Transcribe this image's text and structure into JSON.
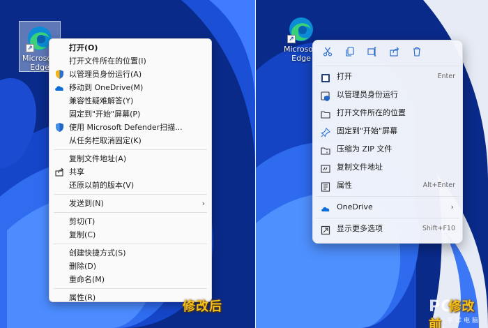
{
  "colors": {
    "accent": "#0067c0",
    "wallpaper_dark": "#0a2a8a",
    "wallpaper_light": "#e8ecf6",
    "caption": "#f4c21a"
  },
  "desktop_icon": {
    "label_line1": "Microsoft",
    "label_line2": "Edge",
    "icon": "edge-icon",
    "overlay": "shortcut-arrow-icon"
  },
  "classic_menu": {
    "groups": [
      [
        {
          "label": "打开(O)",
          "bold": true,
          "icon": ""
        },
        {
          "label": "打开文件所在的位置(I)",
          "icon": ""
        },
        {
          "label": "以管理员身份运行(A)",
          "icon": "shield-icon"
        },
        {
          "label": "移动到 OneDrive(M)",
          "icon": "onedrive-icon"
        },
        {
          "label": "兼容性疑难解答(Y)",
          "icon": ""
        },
        {
          "label": "固定到\"开始\"屏幕(P)",
          "icon": ""
        },
        {
          "label": "使用 Microsoft Defender扫描...",
          "icon": "defender-icon"
        },
        {
          "label": "从任务栏取消固定(K)",
          "icon": ""
        }
      ],
      [
        {
          "label": "复制文件地址(A)",
          "icon": ""
        },
        {
          "label": "共享",
          "icon": "share-icon"
        },
        {
          "label": "还原以前的版本(V)",
          "icon": ""
        }
      ],
      [
        {
          "label": "发送到(N)",
          "icon": "",
          "submenu": true
        }
      ],
      [
        {
          "label": "剪切(T)",
          "icon": ""
        },
        {
          "label": "复制(C)",
          "icon": ""
        }
      ],
      [
        {
          "label": "创建快捷方式(S)",
          "icon": ""
        },
        {
          "label": "删除(D)",
          "icon": ""
        },
        {
          "label": "重命名(M)",
          "icon": ""
        }
      ],
      [
        {
          "label": "属性(R)",
          "icon": ""
        }
      ]
    ]
  },
  "modern_menu": {
    "toolbar": [
      "cut-icon",
      "copy-icon",
      "rename-icon",
      "share-icon",
      "delete-icon"
    ],
    "items_top": [
      {
        "label": "打开",
        "shortcut": "Enter",
        "icon": "app-icon"
      },
      {
        "label": "以管理员身份运行",
        "shortcut": "",
        "icon": "admin-icon"
      },
      {
        "label": "打开文件所在的位置",
        "shortcut": "",
        "icon": "folder-icon"
      },
      {
        "label": "固定到\"开始\"屏幕",
        "shortcut": "",
        "icon": "pin-icon"
      },
      {
        "label": "压缩为 ZIP 文件",
        "shortcut": "",
        "icon": "zip-icon"
      },
      {
        "label": "复制文件地址",
        "shortcut": "",
        "icon": "copy-path-icon"
      },
      {
        "label": "属性",
        "shortcut": "Alt+Enter",
        "icon": "properties-icon"
      }
    ],
    "onedrive": {
      "label": "OneDrive",
      "icon": "onedrive-icon"
    },
    "more": {
      "label": "显示更多选项",
      "shortcut": "Shift+F10",
      "icon": "more-options-icon"
    }
  },
  "captions": {
    "left": "修改后",
    "right": "修改前"
  },
  "watermark": {
    "main": "PC",
    "sub": "太平洋电脑网"
  }
}
